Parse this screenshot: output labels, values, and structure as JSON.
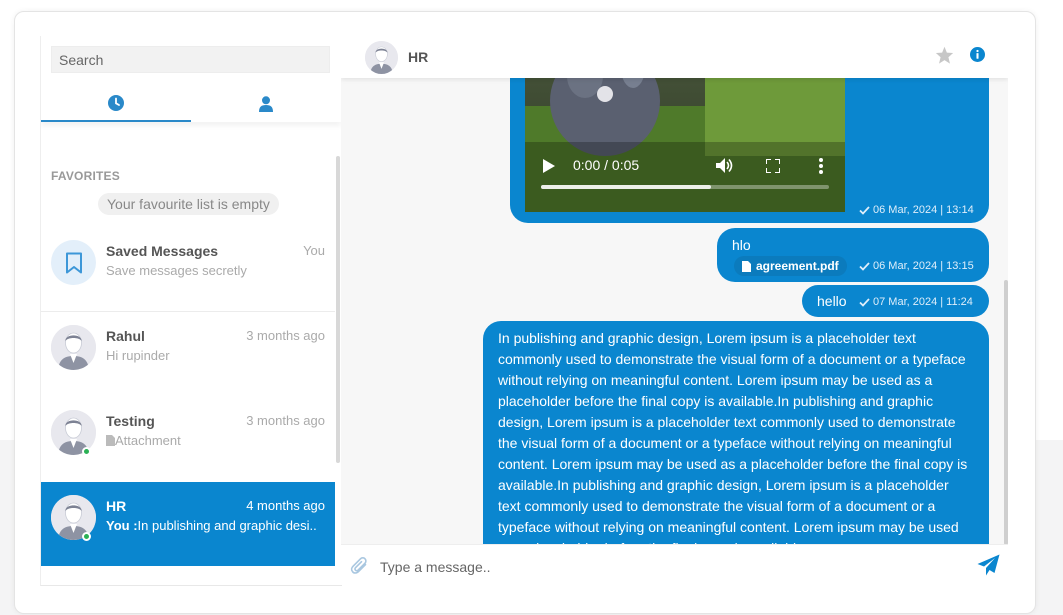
{
  "search": {
    "placeholder": "Search"
  },
  "tabs": [
    {
      "icon": "clock-icon",
      "active": true
    },
    {
      "icon": "user-icon",
      "active": false
    }
  ],
  "favorites": {
    "title": "FAVORITES",
    "empty_text": "Your favourite list is empty"
  },
  "contacts": [
    {
      "name": "Saved Messages",
      "time": "You",
      "message": "Save messages secretly",
      "icon": "bookmark-icon"
    },
    {
      "name": "Rahul",
      "time": "3 months ago",
      "message": "Hi rupinder",
      "online": false
    },
    {
      "name": "Testing",
      "time": "3 months ago",
      "message": "Attachment",
      "online": true,
      "attachment_icon": "file-icon"
    },
    {
      "name": "HR",
      "time": "4 months ago",
      "prefix": "You :",
      "message": "In publishing and graphic desi..",
      "online": true,
      "active": true
    }
  ],
  "chat": {
    "title": "HR",
    "header_icons": [
      "star-icon",
      "info-icon"
    ],
    "video": {
      "time": "0:00 / 0:05",
      "progress": 0.59
    },
    "messages": [
      {
        "type": "video",
        "timestamp": "06 Mar, 2024 | 13:14"
      },
      {
        "type": "text",
        "text": "hlo",
        "file": "agreement.pdf",
        "timestamp": "06 Mar, 2024 | 13:15"
      },
      {
        "type": "text",
        "text": "hello",
        "timestamp": "07 Mar, 2024 | 11:24"
      },
      {
        "type": "text",
        "text": "In publishing and graphic design, Lorem ipsum is a placeholder text commonly used to demonstrate the visual form of a document or a typeface without relying on meaningful content. Lorem ipsum may be used as a placeholder before the final copy is available.In publishing and graphic design, Lorem ipsum is a placeholder text commonly used to demonstrate the visual form of a document or a typeface without relying on meaningful content. Lorem ipsum may be used as a placeholder before the final copy is available.In publishing and graphic design, Lorem ipsum is a placeholder text commonly used to demonstrate the visual form of a document or a typeface without relying on meaningful content. Lorem ipsum may be used as a placeholder before the final copy is available."
      }
    ],
    "composer": {
      "placeholder": "Type a message.."
    }
  },
  "colors": {
    "accent": "#0a86cf",
    "online": "#2bb155"
  }
}
